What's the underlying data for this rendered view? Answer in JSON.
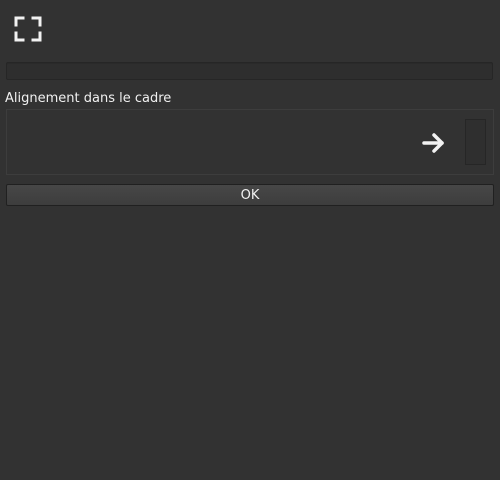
{
  "toolbar": {
    "fullscreen_icon": "fullscreen-icon"
  },
  "text_field": {
    "value": ""
  },
  "alignment": {
    "label": "Alignement dans le cadre",
    "arrow_icon": "arrow-right-icon"
  },
  "actions": {
    "ok_label": "OK"
  },
  "colors": {
    "background": "#323232",
    "text": "#f0f0f0",
    "icon": "#f2f2f2"
  }
}
